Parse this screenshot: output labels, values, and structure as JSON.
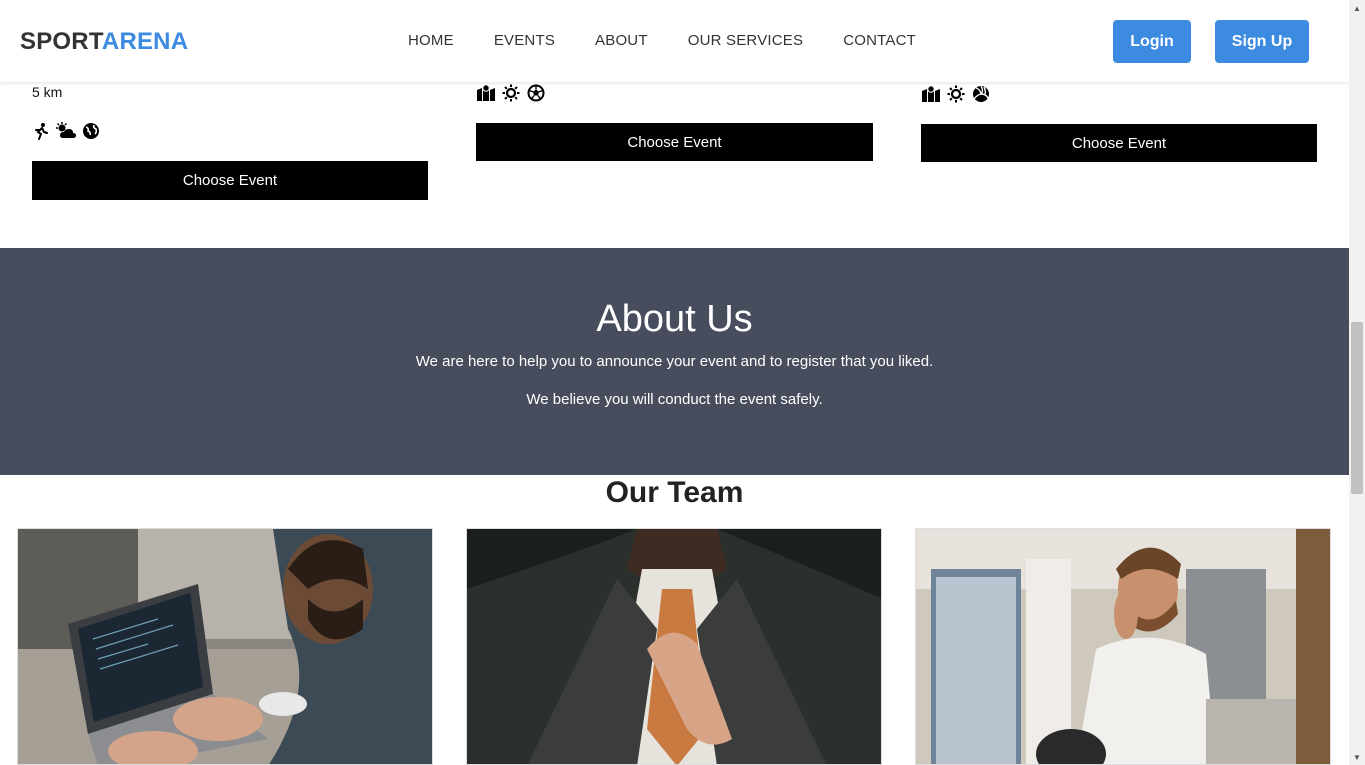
{
  "header": {
    "brand_part1": "SPORT",
    "brand_part2": "ARENA",
    "nav": [
      "HOME",
      "EVENTS",
      "ABOUT",
      "OUR SERVICES",
      "CONTACT"
    ],
    "login_label": "Login",
    "signup_label": "Sign Up"
  },
  "events": {
    "card1": {
      "distance": "5 km",
      "icons": [
        "running-icon",
        "sun-cloud-icon",
        "globe-icon"
      ],
      "button": "Choose Event"
    },
    "card2": {
      "icons": [
        "map-icon",
        "sun-icon",
        "soccer-ball-icon"
      ],
      "button": "Choose Event"
    },
    "card3": {
      "icons": [
        "map-icon",
        "sun-icon",
        "volleyball-icon"
      ],
      "button": "Choose Event"
    }
  },
  "about": {
    "title": "About Us",
    "line1": "We are here to help you to announce your event and to register that you liked.",
    "line2": "We believe you will conduct the event safely."
  },
  "team": {
    "title": "Our Team",
    "members": [
      {
        "image": "man-working-on-laptop-photo"
      },
      {
        "image": "man-adjusting-tie-photo"
      },
      {
        "image": "man-smiling-on-phone-photo"
      }
    ]
  },
  "colors": {
    "accent": "#3d8be0",
    "about_bg": "#474d5c",
    "button_dark": "#000000"
  }
}
